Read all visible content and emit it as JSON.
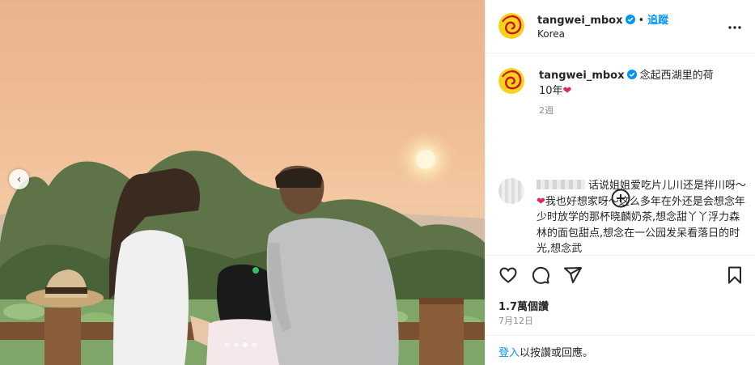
{
  "post": {
    "photo_alt": "photo",
    "carousel_dots": 4,
    "active_dot": 3
  },
  "header": {
    "username": "tangwei_mbox",
    "follow_label": "追蹤",
    "separator": "•",
    "location": "Korea",
    "more_label": "•••"
  },
  "caption": {
    "username": "tangwei_mbox",
    "text": "念起西湖里的荷",
    "line2": "10年",
    "emoji": "❤",
    "time": "2週"
  },
  "comment": {
    "text_part1": "话说姐姐爱吃片儿川还是拌川呀～",
    "emoji": "❤",
    "text_part2": "我也好想家呀～这么多年在外还是会想念年少时放学的那杯晓麟奶茶,想念甜丫丫浮力森林的面包甜点,想念在一公园发呆看落日的时光,想念武"
  },
  "stats": {
    "likes": "1.7萬個讚",
    "date": "7月12日"
  },
  "footer": {
    "login": "登入",
    "rest": "以按讚或回應。"
  },
  "colors": {
    "accent": "#0095f6",
    "verified": "#0095f6",
    "heart": "#e0245e"
  },
  "icons": [
    "chevron-left-icon",
    "verified-badge-icon",
    "more-icon",
    "add-circle-icon",
    "heart-icon",
    "comment-icon",
    "share-icon",
    "bookmark-icon"
  ]
}
